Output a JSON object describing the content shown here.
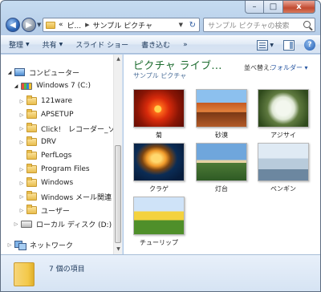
{
  "window": {
    "caption_buttons": {
      "minimize": "–",
      "maximize": "□",
      "close": "x"
    }
  },
  "address_bar": {
    "overflow": "«",
    "crumbs": [
      "ピ...",
      "サンプル ピクチャ"
    ]
  },
  "search": {
    "placeholder": "サンプル ピクチャの検索"
  },
  "toolbar": {
    "organize": "整理",
    "share": "共有",
    "slideshow": "スライド ショー",
    "burn": "書き込む",
    "overflow": "»"
  },
  "nav_tree": {
    "computer": "コンピューター",
    "windows_drive": "Windows 7 (C:)",
    "folders": [
      "121ware",
      "APSETUP",
      "Click!　レコーダー_ソー",
      "DRV",
      "PerfLogs",
      "Program Files",
      "Windows",
      "Windows メール関連",
      "ユーザー"
    ],
    "local_disk": "ローカル ディスク (D:)",
    "network": "ネットワーク"
  },
  "library": {
    "title": "ピクチャ ライブ...",
    "subtitle": "サンプル ピクチャ",
    "arrange_label": "並べ替え:",
    "arrange_value": "フォルダー ▾"
  },
  "thumbnails": [
    {
      "caption": "菊"
    },
    {
      "caption": "砂漠"
    },
    {
      "caption": "アジサイ"
    },
    {
      "caption": "クラゲ"
    },
    {
      "caption": "灯台"
    },
    {
      "caption": "ペンギン"
    },
    {
      "caption": "チューリップ"
    }
  ],
  "details": {
    "status": "7 個の項目"
  }
}
